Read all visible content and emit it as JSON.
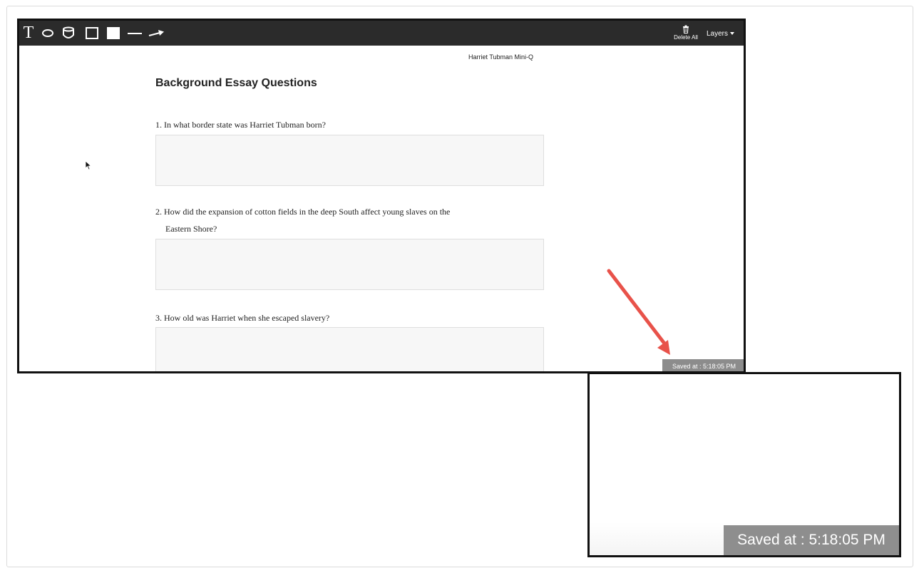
{
  "toolbar": {
    "tools": [
      {
        "name": "text-tool",
        "icon": "text-icon",
        "glyph": "T"
      },
      {
        "name": "ellipse-tool",
        "icon": "ellipse-icon"
      },
      {
        "name": "cylinder-tool",
        "icon": "cylinder-icon"
      },
      {
        "name": "rectangle-tool",
        "icon": "rectangle-icon"
      },
      {
        "name": "filled-rectangle-tool",
        "icon": "filled-rectangle-icon"
      },
      {
        "name": "line-tool",
        "icon": "line-icon"
      },
      {
        "name": "arrow-tool",
        "icon": "arrow-icon"
      }
    ],
    "delete_all_label": "Delete All",
    "layers_label": "Layers"
  },
  "document": {
    "header": "Harriet Tubman Mini-Q",
    "title": "Background Essay Questions",
    "questions": [
      {
        "text": "1. In what border state was Harriet Tubman born?"
      },
      {
        "text": "2. How did the expansion of cotton fields in the deep South affect young slaves on the",
        "continuation": "Eastern Shore?"
      },
      {
        "text": "3. How old was Harriet when she escaped slavery?"
      }
    ]
  },
  "status": {
    "saved_text": "Saved at : 5:18:05 PM"
  },
  "colors": {
    "toolbar_bg": "#2b2b2b",
    "annotation_arrow": "#e8524a",
    "saved_badge_bg": "#8c8c8c"
  }
}
